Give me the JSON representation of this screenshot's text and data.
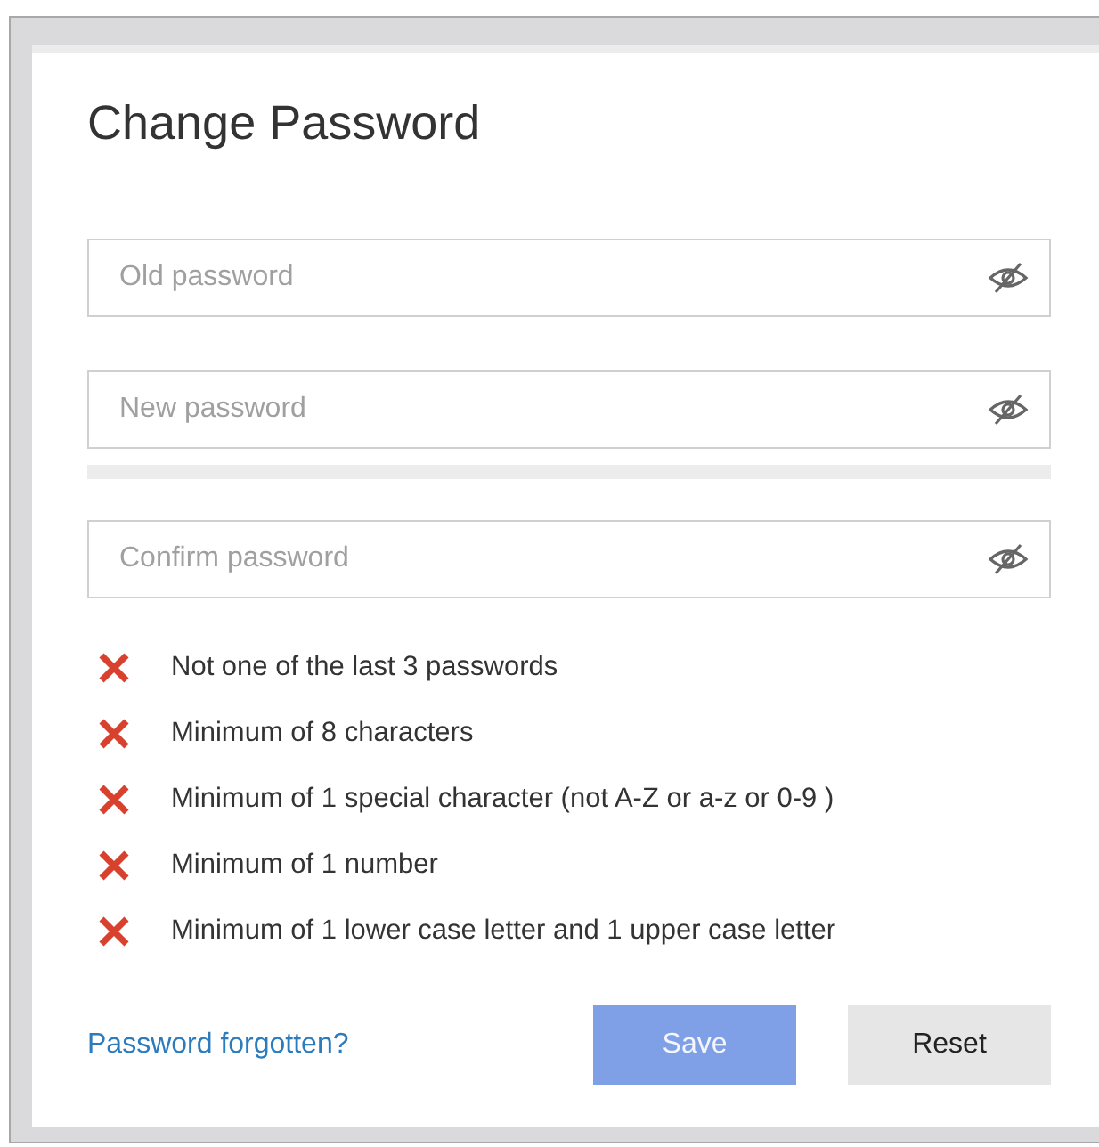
{
  "dialog": {
    "title": "Change Password"
  },
  "fields": [
    {
      "placeholder": "Old password",
      "show_password": false
    },
    {
      "placeholder": "New password",
      "show_password": false,
      "strength": {
        "level": 0
      }
    },
    {
      "placeholder": "Confirm password",
      "show_password": false
    }
  ],
  "rules": [
    {
      "text": "Not one of the last 3 passwords",
      "met": false
    },
    {
      "text": "Minimum of 8 characters",
      "met": false
    },
    {
      "text": "Minimum of 1 special character (not A-Z or a-z or 0-9 )",
      "met": false
    },
    {
      "text": "Minimum of 1 number",
      "met": false
    },
    {
      "text": "Minimum of 1 lower case letter and 1 upper case letter",
      "met": false
    }
  ],
  "link": "Password forgotten?",
  "buttons": [
    {
      "label": "Save",
      "kind": "primary",
      "disabled": true
    },
    {
      "label": "Reset",
      "kind": "secondary",
      "disabled": false
    }
  ]
}
